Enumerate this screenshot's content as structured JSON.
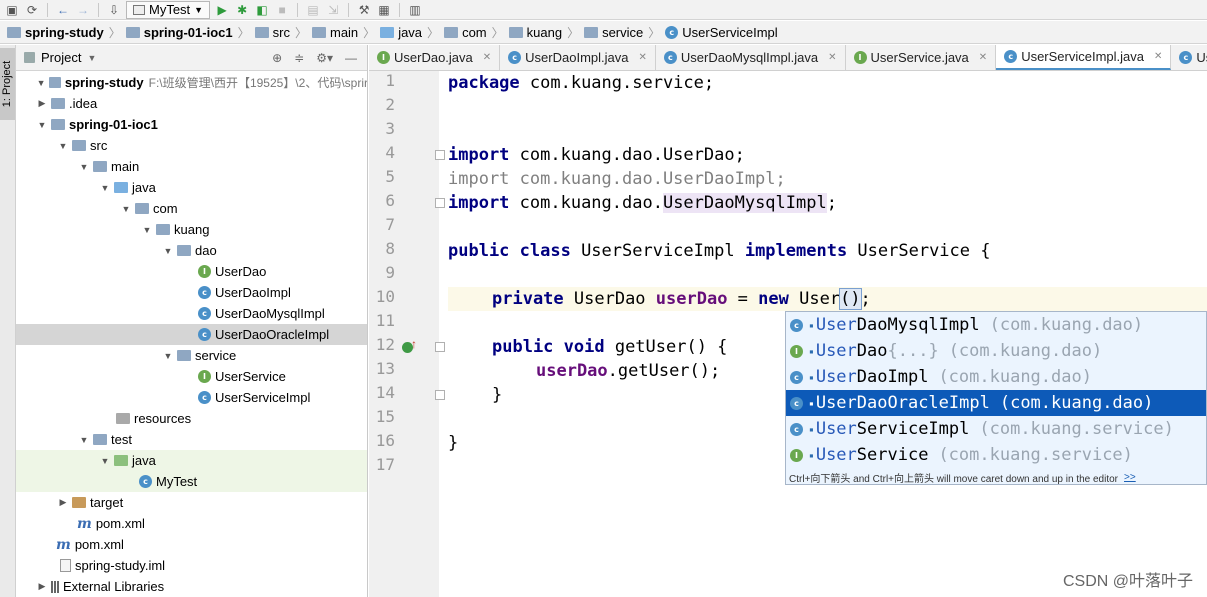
{
  "toolbar": {
    "run_config": "MyTest",
    "icons": [
      "save-icon",
      "sync-icon",
      "back-icon",
      "forward-icon",
      "build-icon",
      "run-icon",
      "debug-icon",
      "coverage-icon",
      "stop-icon",
      "structure-icon",
      "settings-icon",
      "project-structure-icon",
      "sdk-icon"
    ]
  },
  "breadcrumb": [
    "spring-study",
    "spring-01-ioc1",
    "src",
    "main",
    "java",
    "com",
    "kuang",
    "service",
    "UserServiceImpl"
  ],
  "left_stripe": {
    "project_tab": "1: Project"
  },
  "project_panel": {
    "title": "Project",
    "tree": [
      {
        "label": "spring-study",
        "extra": "F:\\班级管理\\西开【19525】\\2、代码\\sprir"
      },
      {
        "label": ".idea"
      },
      {
        "label": "spring-01-ioc1"
      },
      {
        "label": "src"
      },
      {
        "label": "main"
      },
      {
        "label": "java"
      },
      {
        "label": "com"
      },
      {
        "label": "kuang"
      },
      {
        "label": "dao"
      },
      {
        "label": "UserDao"
      },
      {
        "label": "UserDaoImpl"
      },
      {
        "label": "UserDaoMysqlImpl"
      },
      {
        "label": "UserDaoOracleImpl"
      },
      {
        "label": "service"
      },
      {
        "label": "UserService"
      },
      {
        "label": "UserServiceImpl"
      },
      {
        "label": "resources"
      },
      {
        "label": "test"
      },
      {
        "label": "java"
      },
      {
        "label": "MyTest"
      },
      {
        "label": "target"
      },
      {
        "label": "pom.xml"
      },
      {
        "label": "pom.xml"
      },
      {
        "label": "spring-study.iml"
      },
      {
        "label": "External Libraries"
      }
    ]
  },
  "editor": {
    "tabs": [
      {
        "label": "UserDao.java",
        "kind": "interface"
      },
      {
        "label": "UserDaoImpl.java",
        "kind": "class"
      },
      {
        "label": "UserDaoMysqlImpl.java",
        "kind": "class"
      },
      {
        "label": "UserService.java",
        "kind": "interface"
      },
      {
        "label": "UserServiceImpl.java",
        "kind": "class",
        "active": true
      },
      {
        "label": "UserDa",
        "kind": "class"
      }
    ],
    "line_numbers": [
      "1",
      "2",
      "3",
      "4",
      "5",
      "6",
      "7",
      "8",
      "9",
      "10",
      "11",
      "12",
      "13",
      "14",
      "15",
      "16",
      "17"
    ],
    "code": {
      "l1_kw": "package",
      "l1_rest": " com.kuang.service;",
      "l4_kw": "import",
      "l4_rest": " com.kuang.dao.UserDao;",
      "l5_kw": "import",
      "l5_rest": " com.kuang.dao.UserDaoImpl;",
      "l6_kw": "import",
      "l6_pre": " com.kuang.dao.",
      "l6_cls": "UserDaoMysqlImpl",
      "l6_end": ";",
      "l8_kw1": "public class",
      "l8_name": " UserServiceImpl ",
      "l8_kw2": "implements",
      "l8_rest": " UserService {",
      "l10_kw": "private",
      "l10_type": " UserDao ",
      "l10_field": "userDao",
      "l10_eq": " = ",
      "l10_new": "new",
      "l10_call": " User",
      "l10_paren": "()",
      "l10_end": ";",
      "l12_kw": "public void",
      "l12_rest": " getUser() {",
      "l13_field": "userDao",
      "l13_rest": ".getUser();",
      "l14": "}",
      "l16": "}"
    }
  },
  "completion": {
    "items": [
      {
        "kind": "class",
        "match": "User",
        "rest": "DaoMysqlImpl",
        "pkg": "(com.kuang.dao)"
      },
      {
        "kind": "interface",
        "match": "User",
        "rest": "Dao",
        "extra": "{...}",
        "pkg": "(com.kuang.dao)"
      },
      {
        "kind": "class",
        "match": "User",
        "rest": "DaoImpl",
        "pkg": "(com.kuang.dao)"
      },
      {
        "kind": "class",
        "match": "User",
        "rest": "DaoOracleImpl",
        "pkg": "(com.kuang.dao)",
        "selected": true
      },
      {
        "kind": "class",
        "match": "User",
        "rest": "ServiceImpl",
        "pkg": "(com.kuang.service)"
      },
      {
        "kind": "interface",
        "match": "User",
        "rest": "Service",
        "pkg": "(com.kuang.service)"
      }
    ],
    "footer": "Ctrl+向下箭头 and Ctrl+向上箭头 will move caret down and up in the editor",
    "footer_link": ">>"
  },
  "watermark": "CSDN @叶落叶子"
}
